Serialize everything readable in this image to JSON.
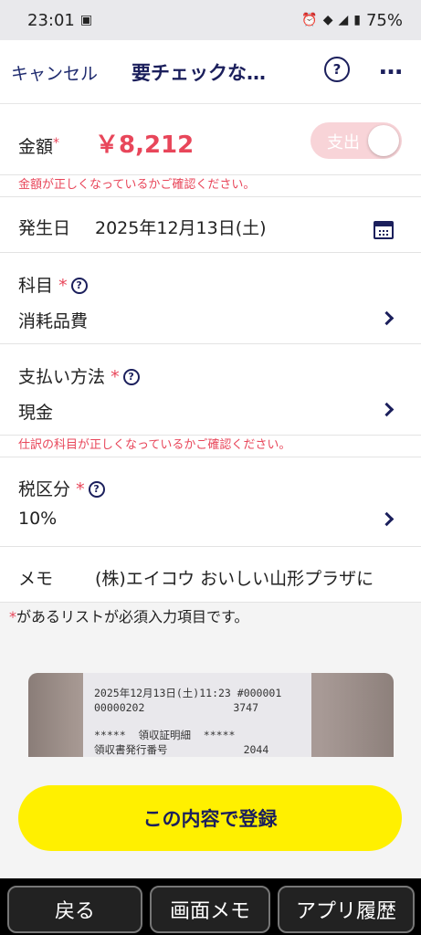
{
  "status_bar": {
    "time": "23:01",
    "battery": "75%"
  },
  "header": {
    "cancel_label": "キャンセル",
    "title": "要チェックな…",
    "help_label": "?",
    "more_label": "…"
  },
  "amount_row": {
    "label": "金額",
    "required_mark": "*",
    "amount": "￥8,212",
    "toggle_label": "支出",
    "toggle_on": true
  },
  "amount_warning": "金額が正しくなっているかご確認ください。",
  "date_row": {
    "label": "発生日",
    "value": "2025年12月13日(土)"
  },
  "account_row": {
    "label": "科目",
    "required_mark": "*",
    "help_label": "?",
    "value": "消耗品費"
  },
  "payment_row": {
    "label": "支払い方法",
    "required_mark": "*",
    "help_label": "?",
    "value": "現金"
  },
  "account_warning": "仕訳の科目が正しくなっているかご確認ください。",
  "tax_row": {
    "label": "税区分",
    "required_mark": "*",
    "help_label": "?",
    "value": "10%"
  },
  "memo_row": {
    "label": "メモ",
    "value": "(株)エイコウ おいしい山形プラザに"
  },
  "required_note": {
    "mark": "*",
    "text": "があるリストが必須入力項目です。"
  },
  "receipt": {
    "line1": "2025年12月13日(土)11:23 #000001",
    "line2": "00000202              3747",
    "line3": "*****  領収証明細  *****",
    "line4": "領収書発行番号            2044"
  },
  "register_button": "この内容で登録",
  "bottom_nav": {
    "back": "戻る",
    "screen_memo": "画面メモ",
    "app_history": "アプリ履歴"
  },
  "colors": {
    "accent_red": "#e8465a",
    "navy": "#1b1f5c",
    "register_yellow": "#fff000"
  }
}
